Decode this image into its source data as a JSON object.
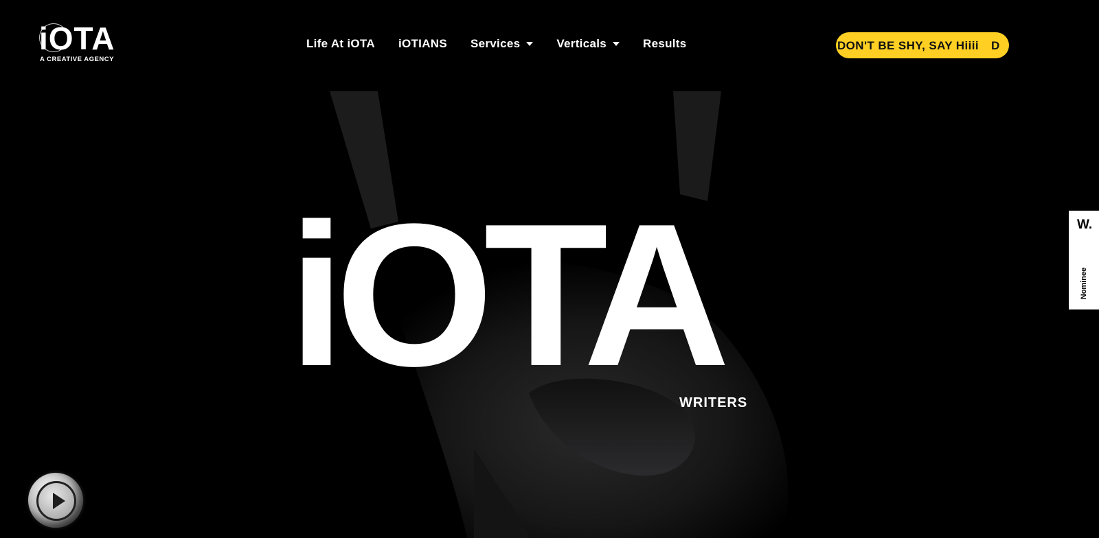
{
  "brand": {
    "logo_text": "iOTA",
    "tagline": "A CREATIVE AGENCY"
  },
  "nav": {
    "items": [
      {
        "label": "Life At iOTA",
        "dropdown": false
      },
      {
        "label": "iOTIANS",
        "dropdown": false
      },
      {
        "label": "Services",
        "dropdown": true
      },
      {
        "label": "Verticals",
        "dropdown": true
      },
      {
        "label": "Results",
        "dropdown": false
      }
    ]
  },
  "cta": {
    "text_visible": "DON'T BE SHY, SAY Hiiii",
    "text_next": "D",
    "color": "#ffd023"
  },
  "hero": {
    "title": "iOTA",
    "rotating_word": "WRITERS"
  },
  "side_badge": {
    "logo": "W.",
    "label": "Nominee"
  },
  "icons": {
    "play": "play-icon",
    "caret": "chevron-down-icon"
  }
}
